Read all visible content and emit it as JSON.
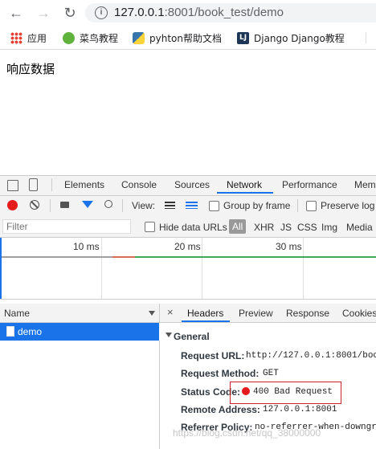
{
  "browser": {
    "url_host": "127.0.0.1",
    "url_rest": ":8001/book_test/demo",
    "bookmarks": [
      {
        "label": "应用",
        "icon": "apps-grid-icon"
      },
      {
        "label": "菜鸟教程",
        "icon": "runoob-icon"
      },
      {
        "label": "pyhton帮助文档",
        "icon": "python-icon"
      },
      {
        "label": "Django Django教程",
        "icon": "lj-icon"
      }
    ]
  },
  "page": {
    "body_text": "响应数据"
  },
  "devtools": {
    "tabs": [
      "Elements",
      "Console",
      "Sources",
      "Network",
      "Performance",
      "Mem"
    ],
    "active_tab": "Network",
    "controls": {
      "view_label": "View:",
      "group_by_frame": "Group by frame",
      "preserve_log": "Preserve log"
    },
    "filter": {
      "placeholder": "Filter",
      "hide_data_urls": "Hide data URLs",
      "types": [
        "All",
        "XHR",
        "JS",
        "CSS",
        "Img",
        "Media"
      ]
    },
    "timeline": {
      "ticks": [
        "10 ms",
        "20 ms",
        "30 ms"
      ]
    },
    "name_column": {
      "header": "Name",
      "rows": [
        "demo"
      ]
    },
    "detail": {
      "tabs": [
        "Headers",
        "Preview",
        "Response",
        "Cookies"
      ],
      "active_tab": "Headers",
      "section_title": "General",
      "rows": [
        {
          "label": "Request URL:",
          "value": "http://127.0.0.1:8001/boo"
        },
        {
          "label": "Request Method:",
          "value": "GET"
        },
        {
          "label": "Status Code:",
          "value": "400 Bad Request"
        },
        {
          "label": "Remote Address:",
          "value": "127.0.0.1:8001"
        },
        {
          "label": "Referrer Policy:",
          "value": "no-referrer-when-downgr"
        }
      ]
    }
  },
  "watermark": "https://blog.csdn.net/qq_38000000",
  "colors": {
    "accent": "#1a73e8",
    "error": "#e41a1c",
    "highlight_box": "#c9242b"
  }
}
